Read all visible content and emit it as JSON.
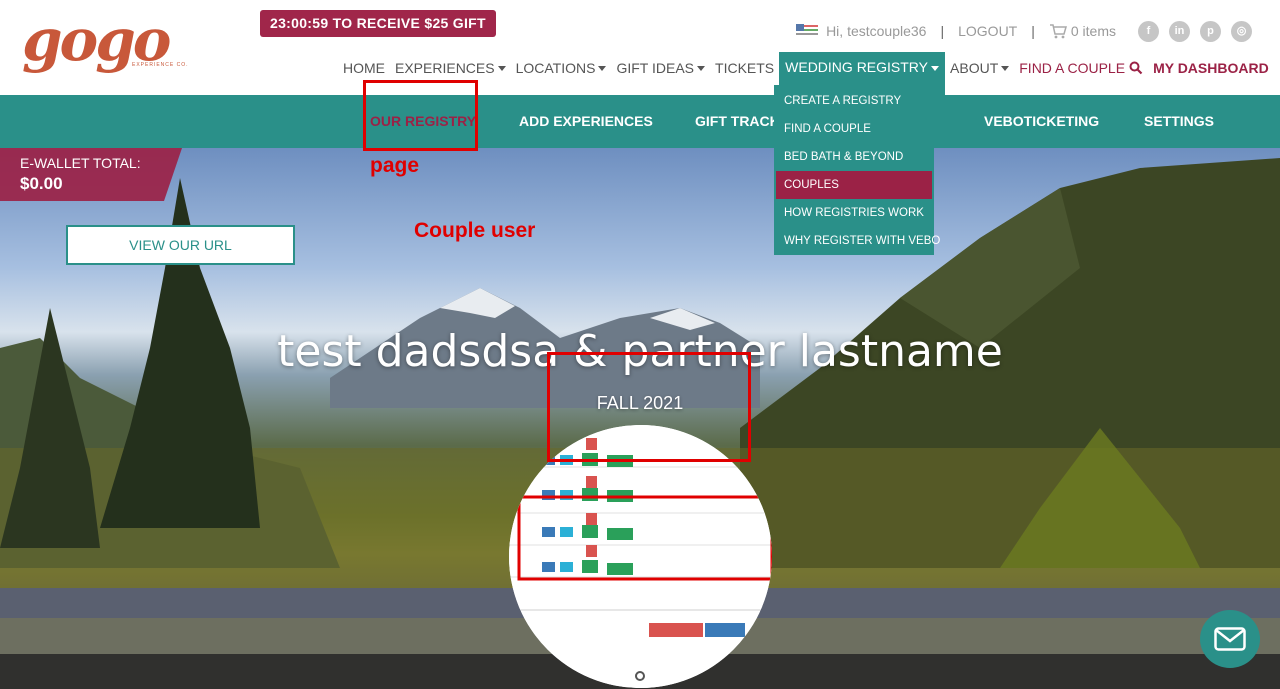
{
  "header": {
    "gift_timer": "23:00:59 TO RECEIVE $25 GIFT",
    "greeting": "Hi, testcouple36",
    "logout": "LOGOUT",
    "cart": "0 items",
    "logo_text": "gogo",
    "logo_sub": "EXPERIENCE CO."
  },
  "mainnav": {
    "home": "HOME",
    "experiences": "EXPERIENCES",
    "locations": "LOCATIONS",
    "gift_ideas": "GIFT IDEAS",
    "tickets": "TICKETS",
    "wedding_registry": "WEDDING REGISTRY",
    "about": "ABOUT",
    "find_a_couple": "FIND A COUPLE",
    "my_dashboard": "MY DASHBOARD"
  },
  "subnav": {
    "our_registry": "OUR REGISTRY",
    "add_experiences": "ADD EXPERIENCES",
    "gift_tracker": "GIFT TRACK",
    "veboticketing": "VEBOTICKETING",
    "settings": "SETTINGS"
  },
  "dropdown": {
    "items": [
      "CREATE A REGISTRY",
      "FIND A COUPLE",
      "BED BATH & BEYOND",
      "COUPLES",
      "HOW REGISTRIES WORK",
      "WHY REGISTER WITH VEBO"
    ]
  },
  "ewallet": {
    "label": "E-WALLET TOTAL:",
    "value": "$0.00"
  },
  "view_url": "VIEW OUR URL",
  "annotations": {
    "page": "page",
    "couple_user": "Couple user"
  },
  "hero": {
    "title": "test dadsdsa  & partner lastname",
    "season": "FALL 2021"
  },
  "colors": {
    "teal": "#2a9089",
    "maroon": "#9b2246",
    "annotation_red": "#e00000"
  }
}
